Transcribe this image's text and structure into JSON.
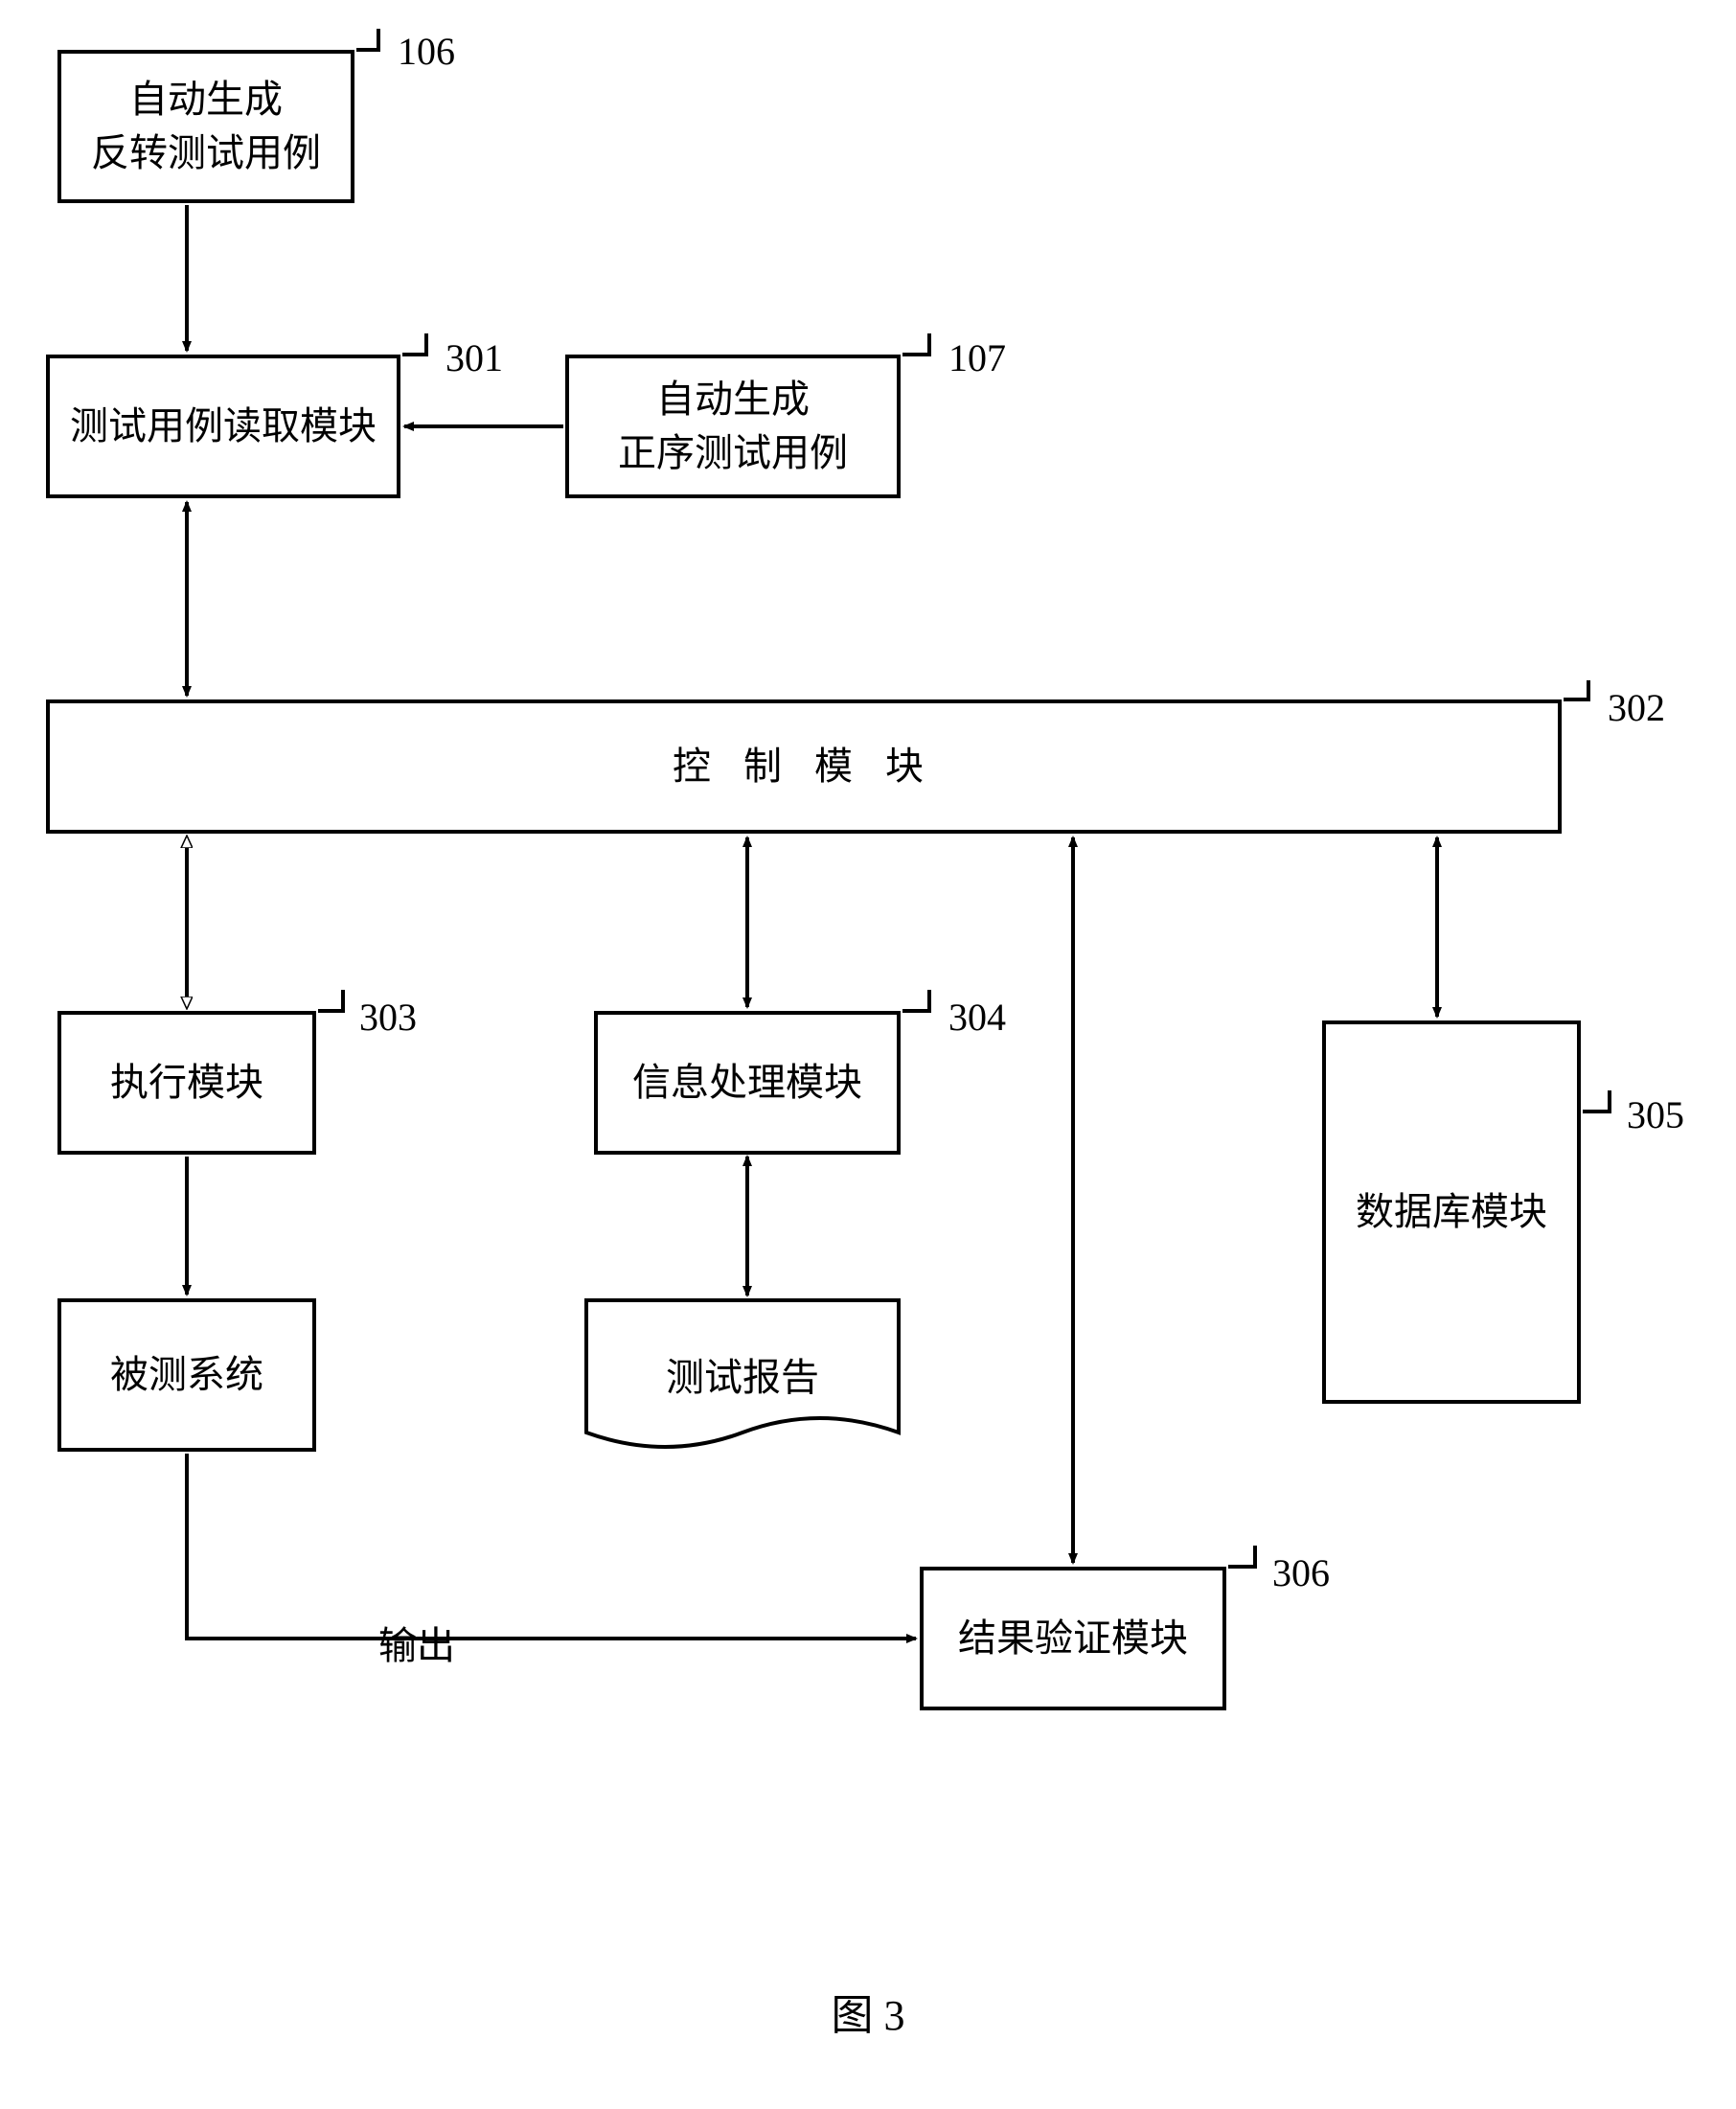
{
  "figure_caption": "图 3",
  "boxes": {
    "auto_gen_reverse": {
      "text": "自动生成\n反转测试用例",
      "ref": "106"
    },
    "auto_gen_forward": {
      "text": "自动生成\n正序测试用例",
      "ref": "107"
    },
    "test_case_reader": {
      "text": "测试用例读取模块",
      "ref": "301"
    },
    "control_module": {
      "text": "控 制 模 块",
      "ref": "302"
    },
    "exec_module": {
      "text": "执行模块",
      "ref": "303"
    },
    "info_module": {
      "text": "信息处理模块",
      "ref": "304"
    },
    "db_module": {
      "text": "数据库模块",
      "ref": "305"
    },
    "result_verify": {
      "text": "结果验证模块",
      "ref": "306"
    },
    "tested_system": {
      "text": "被测系统"
    },
    "test_report": {
      "text": "测试报告"
    }
  },
  "labels": {
    "output": "输出"
  }
}
